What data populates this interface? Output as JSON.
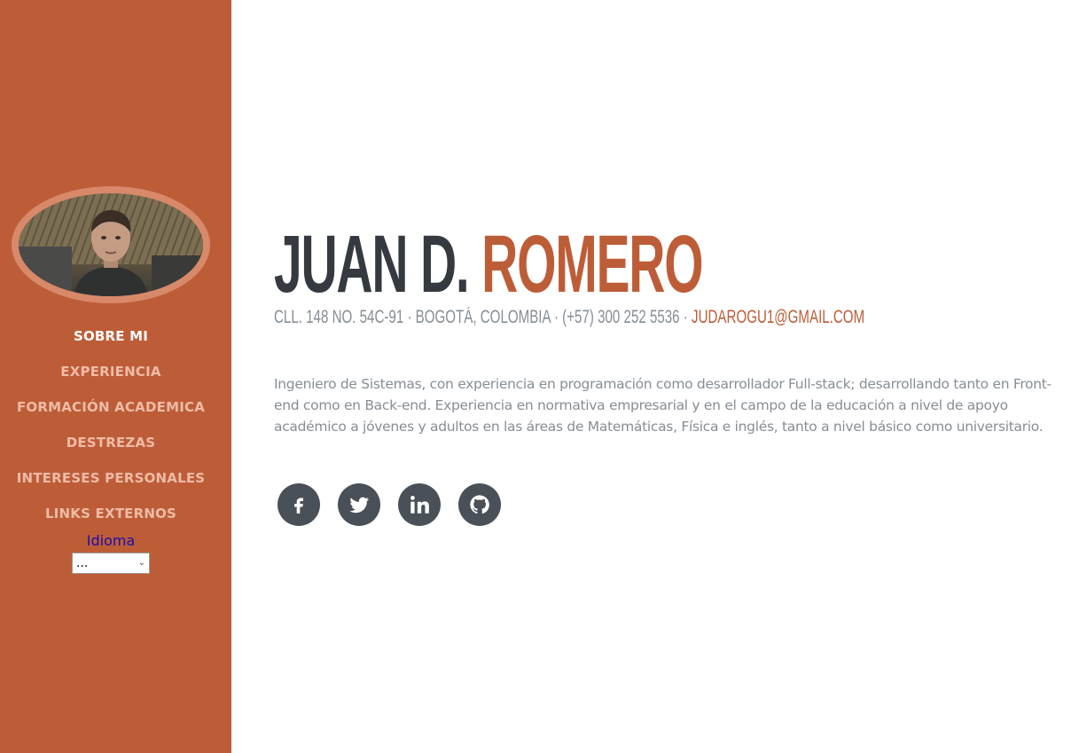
{
  "sidebar": {
    "nav_items": [
      {
        "label": "SOBRE MI",
        "active": true
      },
      {
        "label": "EXPERIENCIA",
        "active": false
      },
      {
        "label": "FORMACIÓN ACADEMICA",
        "active": false
      },
      {
        "label": "DESTREZAS",
        "active": false
      },
      {
        "label": "INTERESES PERSONALES",
        "active": false
      },
      {
        "label": "LINKS EXTERNOS",
        "active": false
      }
    ],
    "language_label": "Idioma",
    "language_select_value": "..."
  },
  "profile": {
    "first_name": "JUAN D.",
    "last_name": "ROMERO",
    "address": "CLL. 148 NO. 54C-91 · BOGOTÁ, COLOMBIA · (+57) 300 252 5536 · ",
    "email": "JUDAROGU1@GMAIL.COM",
    "bio": "Ingeniero de Sistemas, con experiencia en programación como desarrollador Full-stack; desarrollando tanto en Front-end como en Back-end. Experiencia en normativa empresarial y en el campo de la educación a nivel de apoyo académico a jóvenes y adultos en las áreas de Matemáticas, Física e inglés, tanto a nivel básico como universitario."
  },
  "social_links": [
    {
      "icon": "facebook-icon"
    },
    {
      "icon": "twitter-icon"
    },
    {
      "icon": "linkedin-icon"
    },
    {
      "icon": "github-icon"
    }
  ],
  "colors": {
    "primary": "#bd5d38",
    "dark": "#343a40",
    "muted": "#868e96",
    "social_bg": "#495057"
  }
}
